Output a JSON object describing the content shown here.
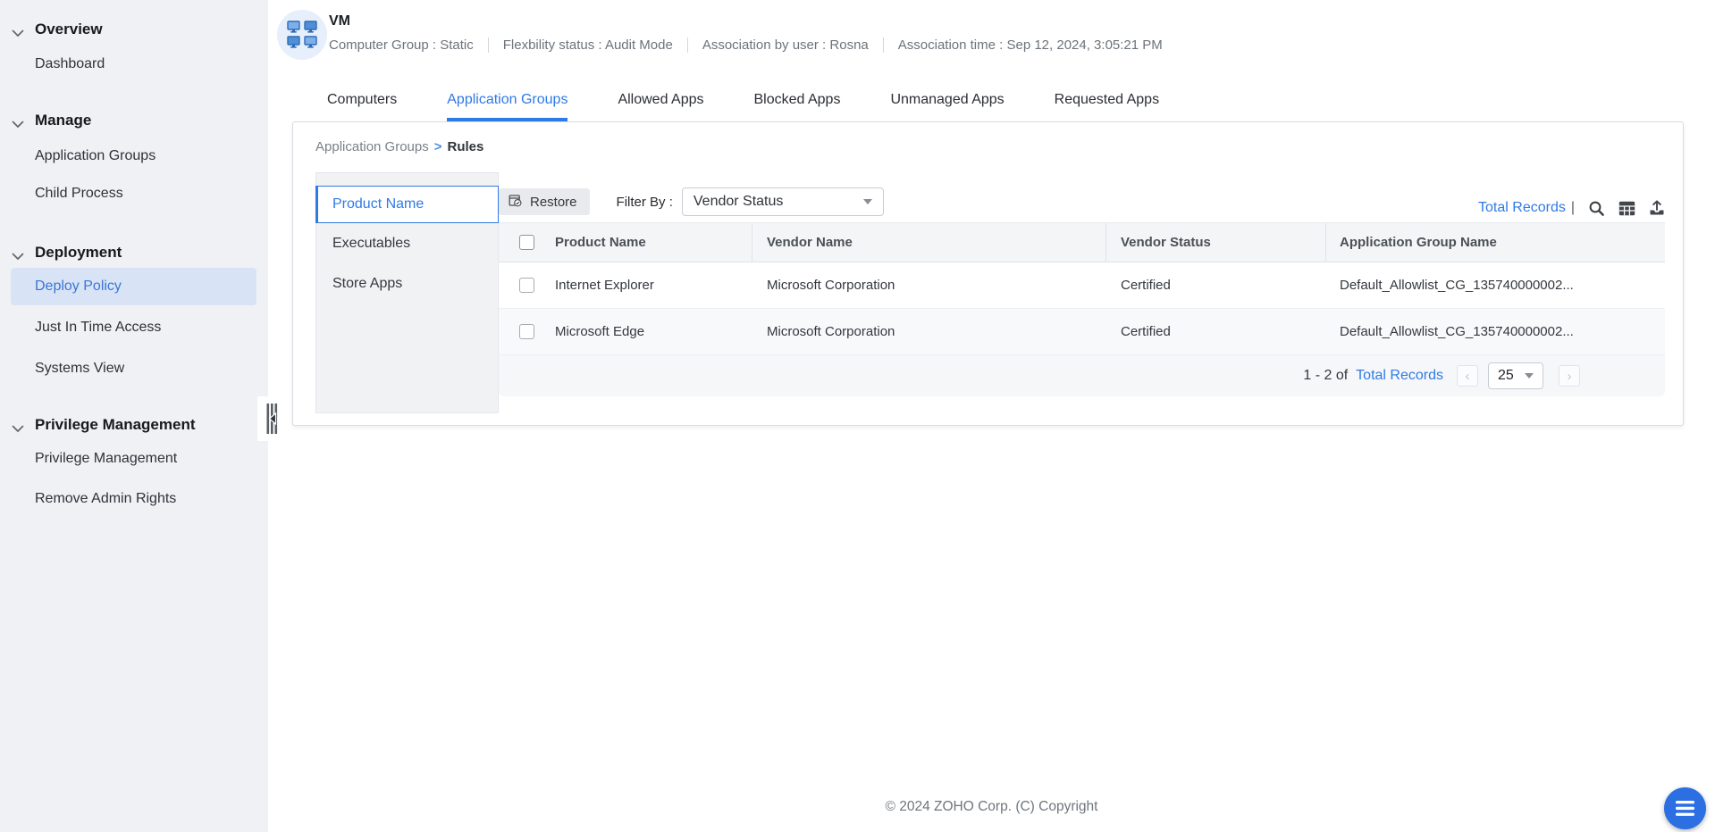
{
  "sidebar": {
    "sections": [
      {
        "title": "Overview",
        "items": [
          {
            "label": "Dashboard"
          }
        ]
      },
      {
        "title": "Manage",
        "items": [
          {
            "label": "Application Groups"
          },
          {
            "label": "Child Process"
          }
        ]
      },
      {
        "title": "Deployment",
        "items": [
          {
            "label": "Deploy Policy"
          },
          {
            "label": "Just In Time Access"
          },
          {
            "label": "Systems View"
          }
        ]
      },
      {
        "title": "Privilege Management",
        "items": [
          {
            "label": "Privilege Management"
          },
          {
            "label": "Remove Admin Rights"
          }
        ]
      }
    ],
    "active_item": "Deploy Policy"
  },
  "header": {
    "title": "VM",
    "avatar_icon": "computer-group-icon",
    "meta": [
      "Computer Group : Static",
      "Flexbility status : Audit Mode",
      "Association by user : Rosna",
      "Association time : Sep 12, 2024, 3:05:21 PM"
    ]
  },
  "tabs": {
    "items": [
      "Computers",
      "Application Groups",
      "Allowed Apps",
      "Blocked Apps",
      "Unmanaged Apps",
      "Requested Apps"
    ],
    "active": "Application Groups"
  },
  "breadcrumb": {
    "parent": "Application Groups",
    "separator": ">",
    "current": "Rules"
  },
  "rules_panel": {
    "items": [
      "Product Name",
      "Executables",
      "Store Apps"
    ],
    "active": "Product Name"
  },
  "toolbar": {
    "restore_label": "Restore",
    "filter_label": "Filter By :",
    "filter_value": "Vendor Status",
    "total_records_label": "Total Records",
    "divider": "|",
    "icons": [
      "search-icon",
      "column-chooser-icon",
      "export-icon"
    ]
  },
  "table": {
    "headers": [
      "Product Name",
      "Vendor Name",
      "Vendor Status",
      "Application Group Name"
    ],
    "rows": [
      {
        "product_name": "Internet Explorer",
        "vendor_name": "Microsoft Corporation",
        "vendor_status": "Certified",
        "application_group_name": "Default_Allowlist_CG_135740000002..."
      },
      {
        "product_name": "Microsoft Edge",
        "vendor_name": "Microsoft Corporation",
        "vendor_status": "Certified",
        "application_group_name": "Default_Allowlist_CG_135740000002..."
      }
    ]
  },
  "pagination": {
    "range_text": "1 - 2 of",
    "total_link": "Total Records",
    "prev_icon": "‹",
    "next_icon": "›",
    "page_size": "25"
  },
  "footer": {
    "copyright": "© 2024 ZOHO Corp. (C) Copyright"
  },
  "colors": {
    "accent": "#2f7ae5",
    "active_nav_bg": "#d8e4f5",
    "fab": "#2b6fe3"
  }
}
